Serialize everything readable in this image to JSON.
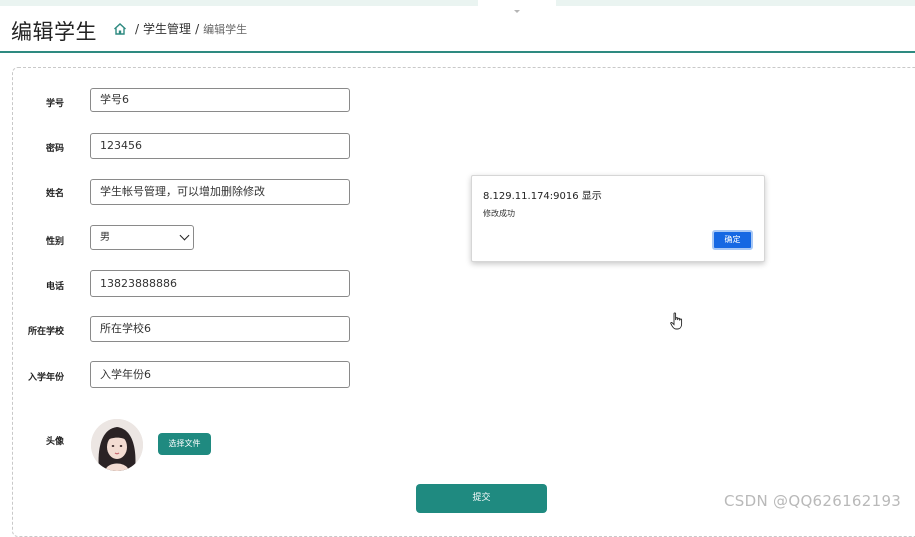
{
  "header": {
    "title": "编辑学生",
    "breadcrumb": {
      "separator": "/",
      "section": "学生管理",
      "current": "编辑学生"
    }
  },
  "form": {
    "fields": {
      "student_no": {
        "label": "学号",
        "value": "学号6"
      },
      "password": {
        "label": "密码",
        "value": "123456"
      },
      "name": {
        "label": "姓名",
        "value": "学生帐号管理，可以增加删除修改"
      },
      "gender": {
        "label": "性别",
        "selected": "男"
      },
      "phone": {
        "label": "电话",
        "value": "13823888886"
      },
      "school": {
        "label": "所在学校",
        "value": "所在学校6"
      },
      "enroll_year": {
        "label": "入学年份",
        "value": "入学年份6"
      },
      "avatar": {
        "label": "头像",
        "file_button": "选择文件"
      }
    },
    "submit_label": "提交"
  },
  "alert": {
    "title": "8.129.11.174:9016 显示",
    "message": "修改成功",
    "ok_label": "确定"
  },
  "watermark": "CSDN @QQ626162193",
  "colors": {
    "accent": "#1f8a80",
    "header_line": "#2e8a80",
    "alert_ok": "#1668e3"
  },
  "icons": {
    "home": "home-icon",
    "select_arrow": "chevron-down-icon",
    "cursor": "hand-cursor-icon"
  }
}
